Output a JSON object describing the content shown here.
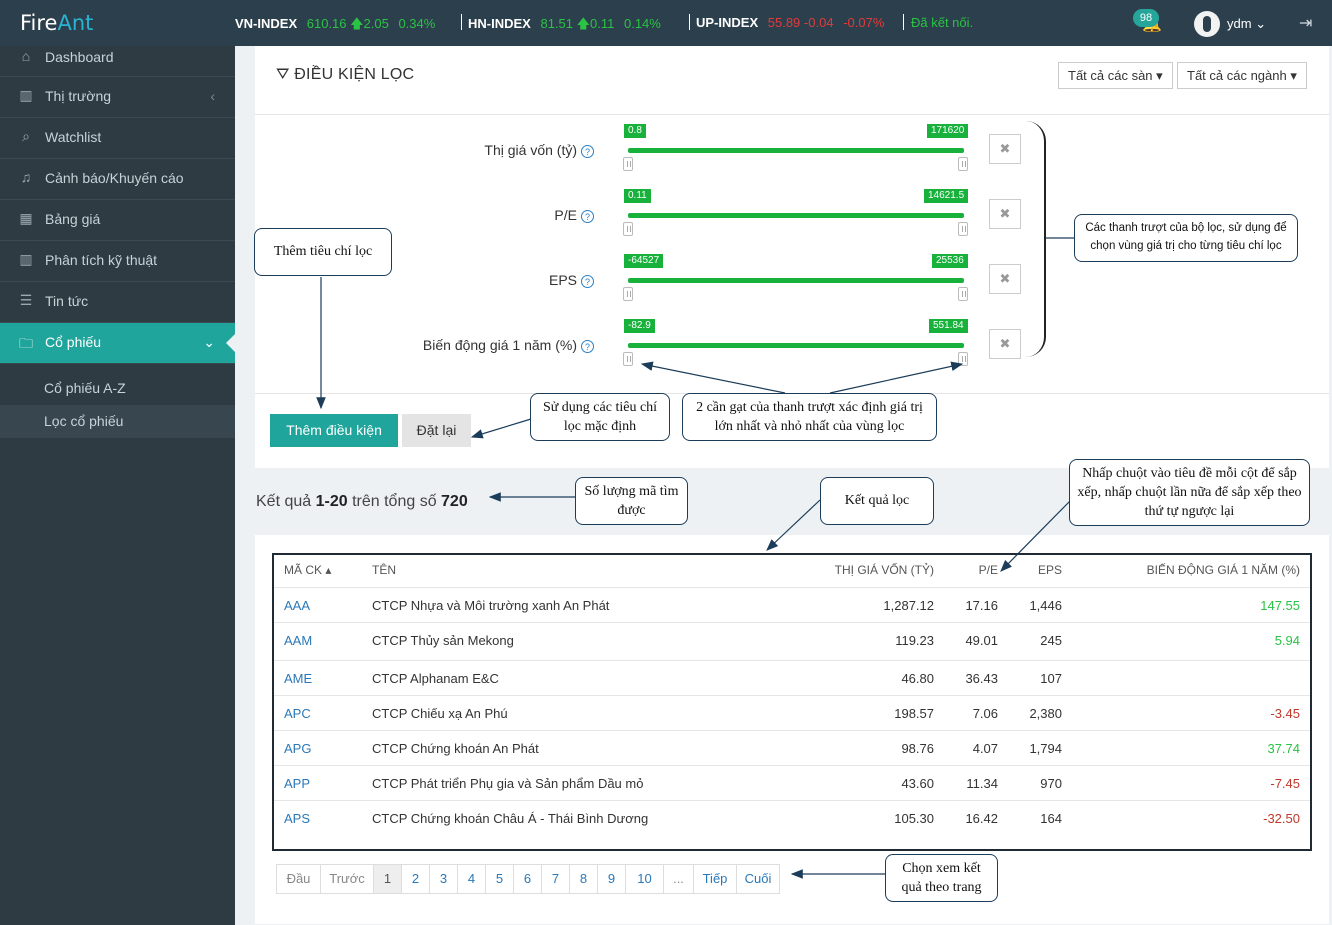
{
  "topbar": {
    "logo_fire": "Fire",
    "logo_ant": "Ant",
    "indices": [
      {
        "name": "VN-INDEX",
        "value": "610.16",
        "change": "2.05",
        "pct": "0.34%",
        "dir": "up"
      },
      {
        "name": "HN-INDEX",
        "value": "81.51",
        "change": "0.11",
        "pct": "0.14%",
        "dir": "up"
      },
      {
        "name": "UP-INDEX",
        "value": "55.89",
        "change": "-0.04",
        "pct": "-0.07%",
        "dir": "down"
      }
    ],
    "status": "Đã kết nối.",
    "notif_count": "98",
    "username": "ydm"
  },
  "sidebar": {
    "items": [
      {
        "label": "Dashboard",
        "icon": "home-icon"
      },
      {
        "label": "Thị trường",
        "icon": "bar-chart-icon"
      },
      {
        "label": "Watchlist",
        "icon": "search-icon"
      },
      {
        "label": "Cảnh báo/Khuyến cáo",
        "icon": "bell-icon"
      },
      {
        "label": "Bảng giá",
        "icon": "table-icon"
      },
      {
        "label": "Phân tích kỹ thuật",
        "icon": "bar-chart-icon"
      },
      {
        "label": "Tin tức",
        "icon": "list-icon"
      },
      {
        "label": "Cổ phiếu",
        "icon": "folder-icon"
      }
    ],
    "subitems": [
      {
        "label": "Cổ phiếu A-Z"
      },
      {
        "label": "Lọc cổ phiếu"
      }
    ]
  },
  "filter": {
    "title": "ĐIỀU KIỆN LỌC",
    "exchange_dropdown": "Tất cả các sàn",
    "industry_dropdown": "Tất cả các ngành",
    "criteria": [
      {
        "label": "Thị giá vốn (tỷ)",
        "min": "0.8",
        "max": "171620"
      },
      {
        "label": "P/E",
        "min": "0.11",
        "max": "14621.5"
      },
      {
        "label": "EPS",
        "min": "-64527",
        "max": "25536"
      },
      {
        "label": "Biến động giá 1 năm (%)",
        "min": "-82.9",
        "max": "551.84"
      }
    ],
    "add_button": "Thêm điều kiện",
    "reset_button": "Đặt lại"
  },
  "results": {
    "prefix": "Kết quả ",
    "range": "1-20",
    "middle": " trên tổng số ",
    "total": "720"
  },
  "table": {
    "headers": {
      "code": "MÃ CK",
      "name": "TÊN",
      "cap": "THỊ GIÁ VỐN (TỶ)",
      "pe": "P/E",
      "eps": "EPS",
      "change": "BIẾN ĐỘNG GIÁ 1 NĂM (%)"
    },
    "rows": [
      {
        "code": "AAA",
        "name": "CTCP Nhựa và Môi trường xanh An Phát",
        "cap": "1,287.12",
        "pe": "17.16",
        "eps": "1,446",
        "change": "147.55",
        "dir": "up"
      },
      {
        "code": "AAM",
        "name": "CTCP Thủy sản Mekong",
        "cap": "119.23",
        "pe": "49.01",
        "eps": "245",
        "change": "5.94",
        "dir": "up"
      },
      {
        "code": "AME",
        "name": "CTCP Alphanam E&C",
        "cap": "46.80",
        "pe": "36.43",
        "eps": "107",
        "change": "",
        "dir": "none"
      },
      {
        "code": "APC",
        "name": "CTCP Chiếu xạ An Phú",
        "cap": "198.57",
        "pe": "7.06",
        "eps": "2,380",
        "change": "-3.45",
        "dir": "down"
      },
      {
        "code": "APG",
        "name": "CTCP Chứng khoán An Phát",
        "cap": "98.76",
        "pe": "4.07",
        "eps": "1,794",
        "change": "37.74",
        "dir": "up"
      },
      {
        "code": "APP",
        "name": "CTCP Phát triển Phụ gia và Sản phẩm Dầu mỏ",
        "cap": "43.60",
        "pe": "11.34",
        "eps": "970",
        "change": "-7.45",
        "dir": "down"
      },
      {
        "code": "APS",
        "name": "CTCP Chứng khoán Châu Á - Thái Bình Dương",
        "cap": "105.30",
        "pe": "16.42",
        "eps": "164",
        "change": "-32.50",
        "dir": "down"
      }
    ]
  },
  "pager": {
    "first": "Đầu",
    "prev": "Trước",
    "pages": [
      "1",
      "2",
      "3",
      "4",
      "5",
      "6",
      "7",
      "8",
      "9",
      "10",
      "..."
    ],
    "next": "Tiếp",
    "last": "Cuối"
  },
  "callouts": {
    "add_criteria": "Thêm tiêu chí lọc",
    "sliders": "Các thanh trượt của bộ lọc, sử dụng để chọn vùng giá trị cho từng tiêu chí lọc",
    "defaults": "Sử dụng các tiêu chí lọc mặc định",
    "handles": "2 cần gạt của thanh trượt xác định giá trị lớn nhất và nhỏ nhất của vùng lọc",
    "count": "Số lượng mã tìm được",
    "results": "Kết quả lọc",
    "sort": "Nhấp chuột vào tiêu đề mỗi cột để sắp xếp, nhấp chuột lần nữa để sắp xếp theo thứ tự ngược lại",
    "paging": "Chọn xem kết quả theo trang"
  },
  "colors": {
    "accent": "#1fa59b",
    "up": "#2ac344",
    "down": "#e23a3a",
    "slider": "#18b13c",
    "sidebar_bg": "#2e3b43",
    "topbar_bg": "#2c3f4c"
  }
}
